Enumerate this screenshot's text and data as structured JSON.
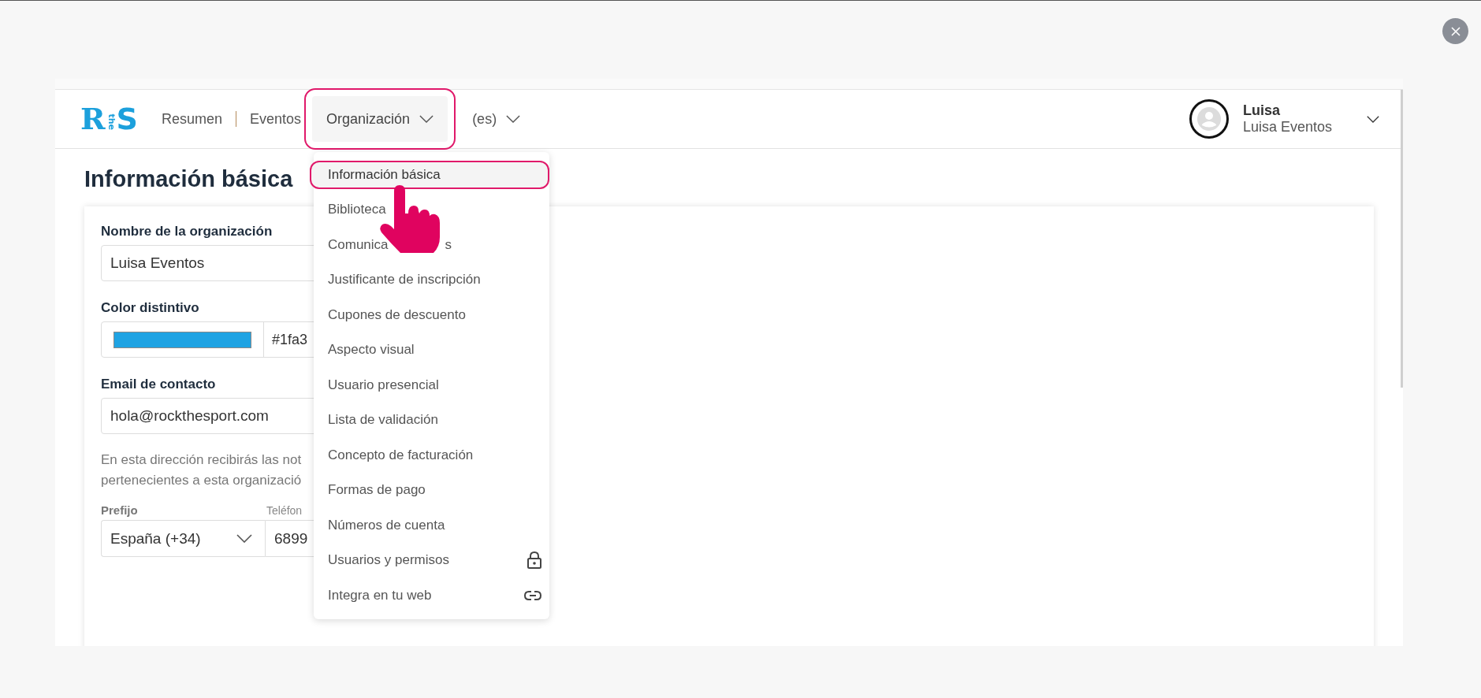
{
  "logo": {
    "parts": [
      "R",
      "the",
      "S"
    ]
  },
  "nav": [
    {
      "label": "Resumen",
      "kind": "link"
    },
    {
      "label": "Eventos",
      "kind": "link"
    },
    {
      "label": "Organización",
      "kind": "dropdown",
      "expanded": true
    },
    {
      "label": "(es)",
      "kind": "dropdown",
      "expanded": false
    }
  ],
  "user": {
    "name": "Luisa",
    "organization": "Luisa Eventos"
  },
  "page_title": "Información básica",
  "form": {
    "name_label": "Nombre de la organización",
    "name_value": "Luisa Eventos",
    "color_label": "Color distintivo",
    "color": "#1fa3e3",
    "color_value": "#1fa3",
    "email_label": "Email de contacto",
    "email_value": "hola@rockthesport.com",
    "help_lines": [
      "En esta dirección recibirás las not",
      "pertenecientes a esta organizació"
    ],
    "prefix_label": "Prefijo",
    "prefix_value": "España (+34)",
    "phone_label": "Teléfon",
    "phone_value": "6899"
  },
  "menu": [
    {
      "label": "Información básica",
      "kind": "text",
      "selected": true
    },
    {
      "label": "Biblioteca",
      "kind": "text",
      "selected": false
    },
    {
      "label": "Comunica",
      "label_end": "s",
      "kind": "text",
      "selected": false
    },
    {
      "label": "Justificante de inscripción",
      "kind": "text",
      "selected": false
    },
    {
      "label": "Cupones de descuento",
      "kind": "text",
      "selected": false
    },
    {
      "label": "Aspecto visual",
      "kind": "text",
      "selected": false
    },
    {
      "label": "Usuario presencial",
      "kind": "text",
      "selected": false
    },
    {
      "label": "Lista de validación",
      "kind": "text",
      "selected": false
    },
    {
      "label": "Concepto de facturación",
      "kind": "text",
      "selected": false
    },
    {
      "label": "Formas de pago",
      "kind": "text",
      "selected": false
    },
    {
      "label": "Números de cuenta",
      "kind": "text",
      "selected": false
    },
    {
      "label": "Usuarios y permisos",
      "kind": "lock",
      "selected": false
    },
    {
      "label": "Integra en tu web",
      "kind": "link",
      "selected": false
    }
  ]
}
